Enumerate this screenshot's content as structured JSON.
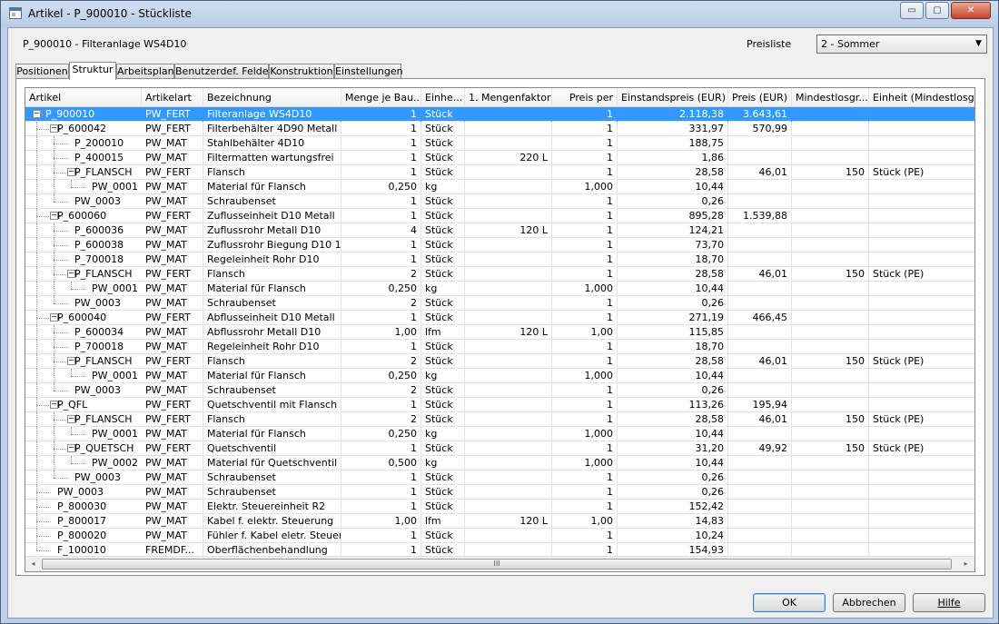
{
  "window": {
    "title": "Artikel - P_900010 - Stückliste",
    "controls": {
      "minimize": "▭",
      "maximize": "▢",
      "close": "✕"
    }
  },
  "header": {
    "article": "P_900010 - Filteranlage WS4D10",
    "preisliste_label": "Preisliste",
    "preisliste_value": "2 - Sommer"
  },
  "tabs": [
    {
      "label": "Positionen",
      "active": false
    },
    {
      "label": "Struktur",
      "active": true
    },
    {
      "label": "Arbeitsplan",
      "active": false
    },
    {
      "label": "Benutzerdef. Felder",
      "active": false
    },
    {
      "label": "Konstruktion",
      "active": false
    },
    {
      "label": "Einstellungen",
      "active": false
    }
  ],
  "columns": [
    "Artikel",
    "Artikelart",
    "Bezeichnung",
    "Menge je Bau...",
    "Einhe...",
    "1. Mengenfaktor",
    "Preis per",
    "Einstandspreis (EUR)",
    "Preis (EUR)",
    "Mindestlosgr...",
    "Einheit (Mindestlosgr..."
  ],
  "rows": [
    {
      "level": 0,
      "expander": "minus",
      "artikel": "P_900010",
      "art": "PW_FERT",
      "bez": "Filteranlage WS4D10",
      "menge": "1",
      "einheit": "Stück",
      "faktor": "",
      "per": "1",
      "einstand": "2.118,38",
      "preis": "3.643,61",
      "mindest": "",
      "einheit_m": "",
      "selected": true
    },
    {
      "level": 1,
      "expander": "minus",
      "artikel": "P_600042",
      "art": "PW_FERT",
      "bez": "Filterbehälter 4D90 Metall",
      "menge": "1",
      "einheit": "Stück",
      "faktor": "",
      "per": "1",
      "einstand": "331,97",
      "preis": "570,99",
      "mindest": "",
      "einheit_m": ""
    },
    {
      "level": 2,
      "expander": "",
      "artikel": "P_200010",
      "art": "PW_MAT",
      "bez": "Stahlbehälter 4D10",
      "menge": "1",
      "einheit": "Stück",
      "faktor": "",
      "per": "1",
      "einstand": "188,75",
      "preis": "",
      "mindest": "",
      "einheit_m": ""
    },
    {
      "level": 2,
      "expander": "",
      "artikel": "P_400015",
      "art": "PW_MAT",
      "bez": "Filtermatten wartungsfrei",
      "menge": "1",
      "einheit": "Stück",
      "faktor": "220 L",
      "per": "1",
      "einstand": "1,86",
      "preis": "",
      "mindest": "",
      "einheit_m": ""
    },
    {
      "level": 2,
      "expander": "minus",
      "artikel": "P_FLANSCH",
      "art": "PW_FERT",
      "bez": "Flansch",
      "menge": "1",
      "einheit": "Stück",
      "faktor": "",
      "per": "1",
      "einstand": "28,58",
      "preis": "46,01",
      "mindest": "150",
      "einheit_m": "Stück (PE)"
    },
    {
      "level": 3,
      "expander": "",
      "artikel": "PW_0001",
      "art": "PW_MAT",
      "bez": "Material für Flansch",
      "menge": "0,250",
      "einheit": "kg",
      "faktor": "",
      "per": "1,000",
      "einstand": "10,44",
      "preis": "",
      "mindest": "",
      "einheit_m": ""
    },
    {
      "level": 2,
      "expander": "",
      "artikel": "PW_0003",
      "art": "PW_MAT",
      "bez": "Schraubenset",
      "menge": "1",
      "einheit": "Stück",
      "faktor": "",
      "per": "1",
      "einstand": "0,26",
      "preis": "",
      "mindest": "",
      "einheit_m": ""
    },
    {
      "level": 1,
      "expander": "minus",
      "artikel": "P_600060",
      "art": "PW_FERT",
      "bez": "Zuflusseinheit D10 Metall",
      "menge": "1",
      "einheit": "Stück",
      "faktor": "",
      "per": "1",
      "einstand": "895,28",
      "preis": "1.539,88",
      "mindest": "",
      "einheit_m": ""
    },
    {
      "level": 2,
      "expander": "",
      "artikel": "P_600036",
      "art": "PW_MAT",
      "bez": "Zuflussrohr Metall D10",
      "menge": "4",
      "einheit": "Stück",
      "faktor": "120 L",
      "per": "1",
      "einstand": "124,21",
      "preis": "",
      "mindest": "",
      "einheit_m": ""
    },
    {
      "level": 2,
      "expander": "",
      "artikel": "P_600038",
      "art": "PW_MAT",
      "bez": "Zuflussrohr Biegung D10 1...",
      "menge": "1",
      "einheit": "Stück",
      "faktor": "",
      "per": "1",
      "einstand": "73,70",
      "preis": "",
      "mindest": "",
      "einheit_m": ""
    },
    {
      "level": 2,
      "expander": "",
      "artikel": "P_700018",
      "art": "PW_MAT",
      "bez": "Regeleinheit Rohr D10",
      "menge": "1",
      "einheit": "Stück",
      "faktor": "",
      "per": "1",
      "einstand": "18,70",
      "preis": "",
      "mindest": "",
      "einheit_m": ""
    },
    {
      "level": 2,
      "expander": "minus",
      "artikel": "P_FLANSCH",
      "art": "PW_FERT",
      "bez": "Flansch",
      "menge": "2",
      "einheit": "Stück",
      "faktor": "",
      "per": "1",
      "einstand": "28,58",
      "preis": "46,01",
      "mindest": "150",
      "einheit_m": "Stück (PE)"
    },
    {
      "level": 3,
      "expander": "",
      "artikel": "PW_0001",
      "art": "PW_MAT",
      "bez": "Material für Flansch",
      "menge": "0,250",
      "einheit": "kg",
      "faktor": "",
      "per": "1,000",
      "einstand": "10,44",
      "preis": "",
      "mindest": "",
      "einheit_m": ""
    },
    {
      "level": 2,
      "expander": "",
      "artikel": "PW_0003",
      "art": "PW_MAT",
      "bez": "Schraubenset",
      "menge": "2",
      "einheit": "Stück",
      "faktor": "",
      "per": "1",
      "einstand": "0,26",
      "preis": "",
      "mindest": "",
      "einheit_m": ""
    },
    {
      "level": 1,
      "expander": "minus",
      "artikel": "P_600040",
      "art": "PW_FERT",
      "bez": "Abflusseinheit D10 Metall",
      "menge": "1",
      "einheit": "Stück",
      "faktor": "",
      "per": "1",
      "einstand": "271,19",
      "preis": "466,45",
      "mindest": "",
      "einheit_m": ""
    },
    {
      "level": 2,
      "expander": "",
      "artikel": "P_600034",
      "art": "PW_MAT",
      "bez": "Abflussrohr Metall D10",
      "menge": "1,00",
      "einheit": "lfm",
      "faktor": "120 L",
      "per": "1,00",
      "einstand": "115,85",
      "preis": "",
      "mindest": "",
      "einheit_m": ""
    },
    {
      "level": 2,
      "expander": "",
      "artikel": "P_700018",
      "art": "PW_MAT",
      "bez": "Regeleinheit Rohr D10",
      "menge": "1",
      "einheit": "Stück",
      "faktor": "",
      "per": "1",
      "einstand": "18,70",
      "preis": "",
      "mindest": "",
      "einheit_m": ""
    },
    {
      "level": 2,
      "expander": "minus",
      "artikel": "P_FLANSCH",
      "art": "PW_FERT",
      "bez": "Flansch",
      "menge": "2",
      "einheit": "Stück",
      "faktor": "",
      "per": "1",
      "einstand": "28,58",
      "preis": "46,01",
      "mindest": "150",
      "einheit_m": "Stück (PE)"
    },
    {
      "level": 3,
      "expander": "",
      "artikel": "PW_0001",
      "art": "PW_MAT",
      "bez": "Material für Flansch",
      "menge": "0,250",
      "einheit": "kg",
      "faktor": "",
      "per": "1,000",
      "einstand": "10,44",
      "preis": "",
      "mindest": "",
      "einheit_m": ""
    },
    {
      "level": 2,
      "expander": "",
      "artikel": "PW_0003",
      "art": "PW_MAT",
      "bez": "Schraubenset",
      "menge": "2",
      "einheit": "Stück",
      "faktor": "",
      "per": "1",
      "einstand": "0,26",
      "preis": "",
      "mindest": "",
      "einheit_m": ""
    },
    {
      "level": 1,
      "expander": "minus",
      "artikel": "P_QFL",
      "art": "PW_FERT",
      "bez": "Quetschventil mit Flansch",
      "menge": "1",
      "einheit": "Stück",
      "faktor": "",
      "per": "1",
      "einstand": "113,26",
      "preis": "195,94",
      "mindest": "",
      "einheit_m": ""
    },
    {
      "level": 2,
      "expander": "minus",
      "artikel": "P_FLANSCH",
      "art": "PW_FERT",
      "bez": "Flansch",
      "menge": "2",
      "einheit": "Stück",
      "faktor": "",
      "per": "1",
      "einstand": "28,58",
      "preis": "46,01",
      "mindest": "150",
      "einheit_m": "Stück (PE)"
    },
    {
      "level": 3,
      "expander": "",
      "artikel": "PW_0001",
      "art": "PW_MAT",
      "bez": "Material für Flansch",
      "menge": "0,250",
      "einheit": "kg",
      "faktor": "",
      "per": "1,000",
      "einstand": "10,44",
      "preis": "",
      "mindest": "",
      "einheit_m": ""
    },
    {
      "level": 2,
      "expander": "minus",
      "artikel": "P_QUETSCH",
      "art": "PW_FERT",
      "bez": "Quetschventil",
      "menge": "1",
      "einheit": "Stück",
      "faktor": "",
      "per": "1",
      "einstand": "31,20",
      "preis": "49,92",
      "mindest": "150",
      "einheit_m": "Stück (PE)"
    },
    {
      "level": 3,
      "expander": "",
      "artikel": "PW_0002",
      "art": "PW_MAT",
      "bez": "Material für Quetschventil",
      "menge": "0,500",
      "einheit": "kg",
      "faktor": "",
      "per": "1,000",
      "einstand": "10,44",
      "preis": "",
      "mindest": "",
      "einheit_m": ""
    },
    {
      "level": 2,
      "expander": "",
      "artikel": "PW_0003",
      "art": "PW_MAT",
      "bez": "Schraubenset",
      "menge": "1",
      "einheit": "Stück",
      "faktor": "",
      "per": "1",
      "einstand": "0,26",
      "preis": "",
      "mindest": "",
      "einheit_m": ""
    },
    {
      "level": 1,
      "expander": "",
      "artikel": "PW_0003",
      "art": "PW_MAT",
      "bez": "Schraubenset",
      "menge": "1",
      "einheit": "Stück",
      "faktor": "",
      "per": "1",
      "einstand": "0,26",
      "preis": "",
      "mindest": "",
      "einheit_m": ""
    },
    {
      "level": 1,
      "expander": "",
      "artikel": "P_800030",
      "art": "PW_MAT",
      "bez": "Elektr. Steuereinheit R2",
      "menge": "1",
      "einheit": "Stück",
      "faktor": "",
      "per": "1",
      "einstand": "152,42",
      "preis": "",
      "mindest": "",
      "einheit_m": ""
    },
    {
      "level": 1,
      "expander": "",
      "artikel": "P_800017",
      "art": "PW_MAT",
      "bez": "Kabel f. elektr. Steuerung",
      "menge": "1,00",
      "einheit": "lfm",
      "faktor": "120 L",
      "per": "1,00",
      "einstand": "14,83",
      "preis": "",
      "mindest": "",
      "einheit_m": ""
    },
    {
      "level": 1,
      "expander": "",
      "artikel": "P_800020",
      "art": "PW_MAT",
      "bez": "Fühler f. Kabel eletr. Steuer...",
      "menge": "1",
      "einheit": "Stück",
      "faktor": "",
      "per": "1",
      "einstand": "10,24",
      "preis": "",
      "mindest": "",
      "einheit_m": ""
    },
    {
      "level": 1,
      "expander": "",
      "artikel": "F_100010",
      "art": "FREMDF...",
      "bez": "Oberflächenbehandlung",
      "menge": "1",
      "einheit": "Stück",
      "faktor": "",
      "per": "1",
      "einstand": "154,93",
      "preis": "",
      "mindest": "",
      "einheit_m": ""
    }
  ],
  "scrollbar": {
    "left": "◂",
    "right": "▸",
    "grip": "III"
  },
  "buttons": {
    "ok": "OK",
    "cancel": "Abbrechen",
    "help": "Hilfe"
  },
  "colors": {
    "selection": "#3399ff",
    "window_frame": "#bcd0e8"
  }
}
